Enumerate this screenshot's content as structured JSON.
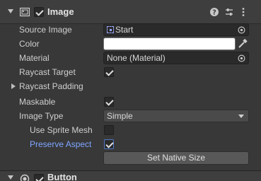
{
  "component": {
    "title": "Image",
    "enabled": true,
    "fields": {
      "source_image": {
        "label": "Source Image",
        "value": "Start"
      },
      "color": {
        "label": "Color",
        "value": "#ffffff"
      },
      "material": {
        "label": "Material",
        "value": "None (Material)"
      },
      "raycast_target": {
        "label": "Raycast Target",
        "checked": true
      },
      "raycast_padding": {
        "label": "Raycast Padding"
      },
      "maskable": {
        "label": "Maskable",
        "checked": true
      },
      "image_type": {
        "label": "Image Type",
        "value": "Simple"
      },
      "use_sprite_mesh": {
        "label": "Use Sprite Mesh",
        "checked": false
      },
      "preserve_aspect": {
        "label": "Preserve Aspect",
        "checked": true
      }
    },
    "set_native_size_label": "Set Native Size"
  },
  "next_component": {
    "title": "Button",
    "enabled": true
  },
  "icons": [
    "foldout-arrow-icon",
    "image-component-icon",
    "help-icon",
    "presets-icon",
    "more-options-icon",
    "object-picker-icon",
    "eyedropper-icon",
    "dropdown-arrow-icon",
    "button-component-icon"
  ]
}
